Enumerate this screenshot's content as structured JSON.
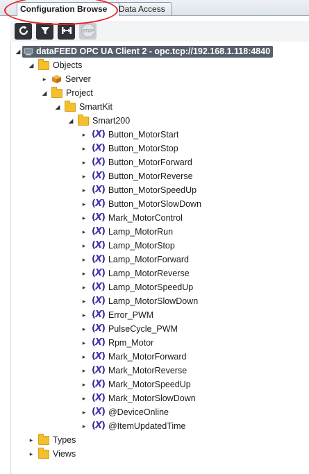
{
  "tabs": [
    {
      "label": "Configuration Browse",
      "active": true
    },
    {
      "label": "Data Access",
      "active": false
    }
  ],
  "toolbar": {
    "buttons": [
      {
        "icon": "refresh-icon",
        "enabled": true
      },
      {
        "icon": "filter-icon",
        "enabled": true
      },
      {
        "icon": "connect-icon",
        "enabled": true
      },
      {
        "icon": "stop-icon",
        "label": "STOP",
        "enabled": false
      }
    ]
  },
  "tree": {
    "root": {
      "label": "dataFEED OPC UA Client 2 - opc.tcp://192.168.1.118:4840",
      "icon": "server-connection-icon",
      "expanded": true
    },
    "objects": {
      "label": "Objects",
      "icon": "folder-icon",
      "expanded": true
    },
    "server": {
      "label": "Server",
      "icon": "package-icon",
      "expanded": false
    },
    "project": {
      "label": "Project",
      "icon": "folder-icon",
      "expanded": true
    },
    "smartkit": {
      "label": "SmartKit",
      "icon": "folder-icon",
      "expanded": true
    },
    "smart200": {
      "label": "Smart200",
      "icon": "folder-icon",
      "expanded": true
    },
    "variables": [
      "Button_MotorStart",
      "Button_MotorStop",
      "Button_MotorForward",
      "Button_MotorReverse",
      "Button_MotorSpeedUp",
      "Button_MotorSlowDown",
      "Mark_MotorControl",
      "Lamp_MotorRun",
      "Lamp_MotorStop",
      "Lamp_MotorForward",
      "Lamp_MotorReverse",
      "Lamp_MotorSpeedUp",
      "Lamp_MotorSlowDown",
      "Error_PWM",
      "PulseCycle_PWM",
      "Rpm_Motor",
      "Mark_MotorForward",
      "Mark_MotorReverse",
      "Mark_MotorSpeedUp",
      "Mark_MotorSlowDown",
      "@DeviceOnline",
      "@ItemUpdatedTime"
    ],
    "types": {
      "label": "Types",
      "icon": "folder-icon",
      "expanded": false
    },
    "views": {
      "label": "Views",
      "icon": "folder-icon",
      "expanded": false
    }
  },
  "colors": {
    "highlight_ring": "#e52424",
    "root_bar": "#55606c",
    "folder": "#f3bf2f",
    "variable_icon": "#2a2f8a"
  }
}
